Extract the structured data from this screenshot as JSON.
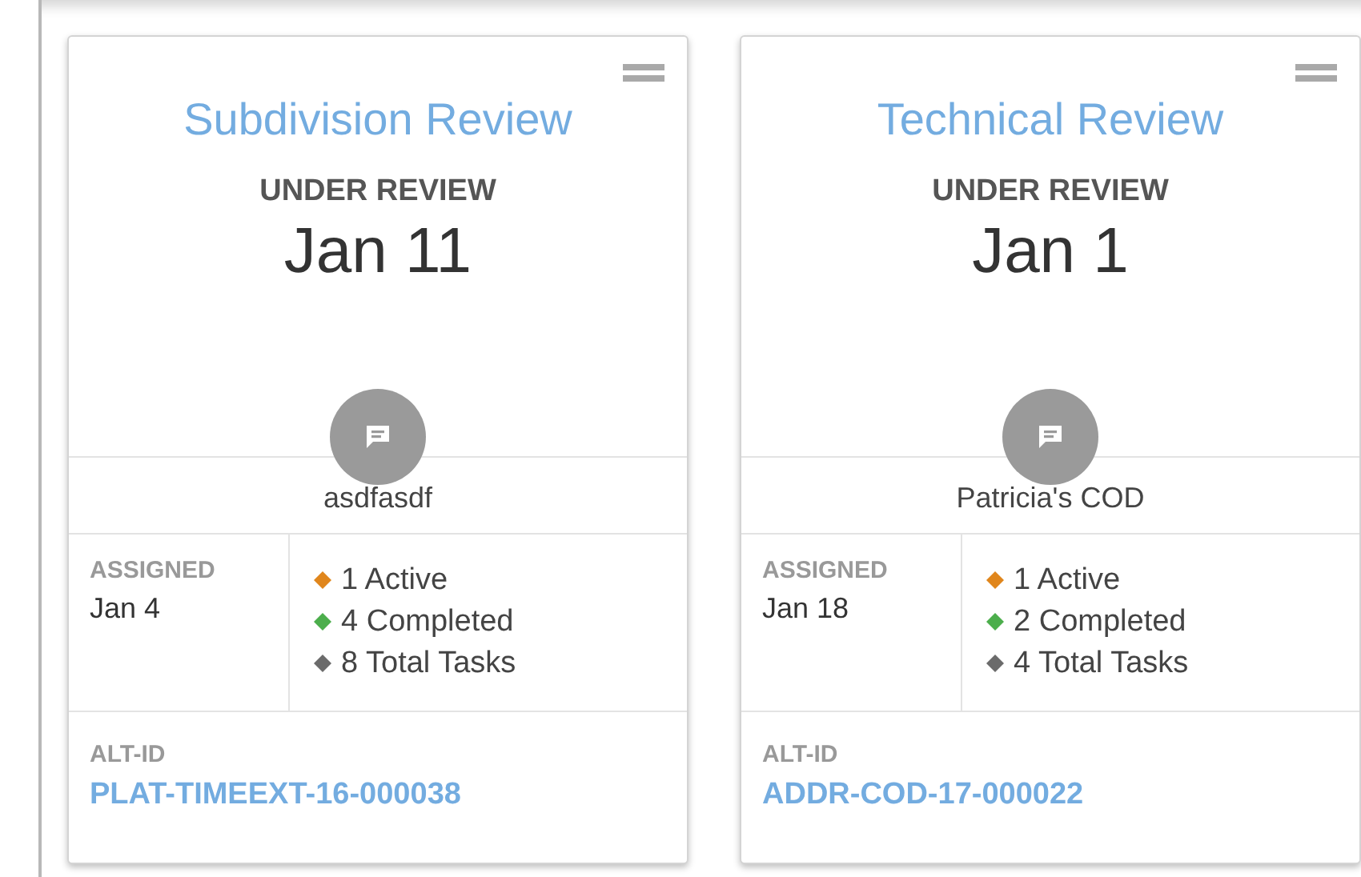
{
  "cards": [
    {
      "title": "Subdivision Review",
      "status": "UNDER REVIEW",
      "date": "Jan 11",
      "name": "asdfasdf",
      "assigned_label": "ASSIGNED",
      "assigned_date": "Jan 4",
      "stats": [
        {
          "text": "1 Active",
          "color": "#e0861c"
        },
        {
          "text": "4 Completed",
          "color": "#4cae4c"
        },
        {
          "text": "8 Total Tasks",
          "color": "#6b6b6b"
        }
      ],
      "alt_id_label": "ALT-ID",
      "alt_id": "PLAT-TIMEEXT-16-000038"
    },
    {
      "title": "Technical Review",
      "status": "UNDER REVIEW",
      "date": "Jan 1",
      "name": "Patricia's COD",
      "assigned_label": "ASSIGNED",
      "assigned_date": "Jan 18",
      "stats": [
        {
          "text": "1 Active",
          "color": "#e0861c"
        },
        {
          "text": "2 Completed",
          "color": "#4cae4c"
        },
        {
          "text": "4 Total Tasks",
          "color": "#6b6b6b"
        }
      ],
      "alt_id_label": "ALT-ID",
      "alt_id": "ADDR-COD-17-000022"
    }
  ]
}
